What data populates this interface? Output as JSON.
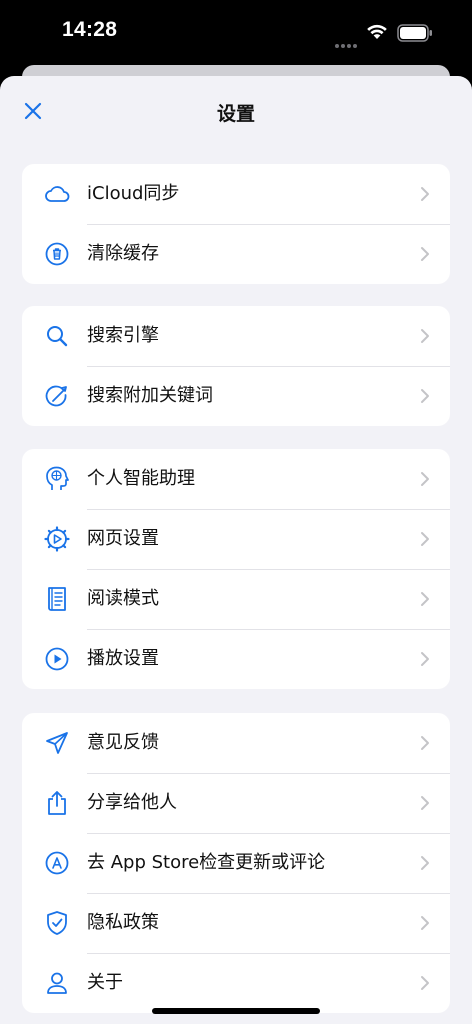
{
  "status_bar": {
    "time": "14:28",
    "icons": [
      "signal-dots-icon",
      "wifi-icon",
      "battery-icon"
    ]
  },
  "header": {
    "title": "设置",
    "close_icon": "close-icon"
  },
  "colors": {
    "accent": "#1a73e8",
    "background": "#f2f2f7",
    "card": "#ffffff",
    "text": "#111111",
    "chevron": "#c4c4c7"
  },
  "groups": [
    {
      "items": [
        {
          "label": "iCloud同步",
          "icon": "cloud-icon"
        },
        {
          "label": "清除缓存",
          "icon": "trash-icon"
        }
      ]
    },
    {
      "items": [
        {
          "label": "搜索引擎",
          "icon": "search-icon"
        },
        {
          "label": "搜索附加关键词",
          "icon": "keyword-edit-icon"
        }
      ]
    },
    {
      "items": [
        {
          "label": "个人智能助理",
          "icon": "brain-head-icon"
        },
        {
          "label": "网页设置",
          "icon": "gear-play-icon"
        },
        {
          "label": "阅读模式",
          "icon": "book-icon"
        },
        {
          "label": "播放设置",
          "icon": "play-circle-icon"
        }
      ]
    },
    {
      "items": [
        {
          "label": "意见反馈",
          "icon": "paper-plane-icon"
        },
        {
          "label": "分享给他人",
          "icon": "share-icon"
        },
        {
          "label": "去 App Store检查更新或评论",
          "icon": "app-store-icon"
        },
        {
          "label": "隐私政策",
          "icon": "shield-check-icon"
        },
        {
          "label": "关于",
          "icon": "person-icon"
        }
      ]
    }
  ]
}
